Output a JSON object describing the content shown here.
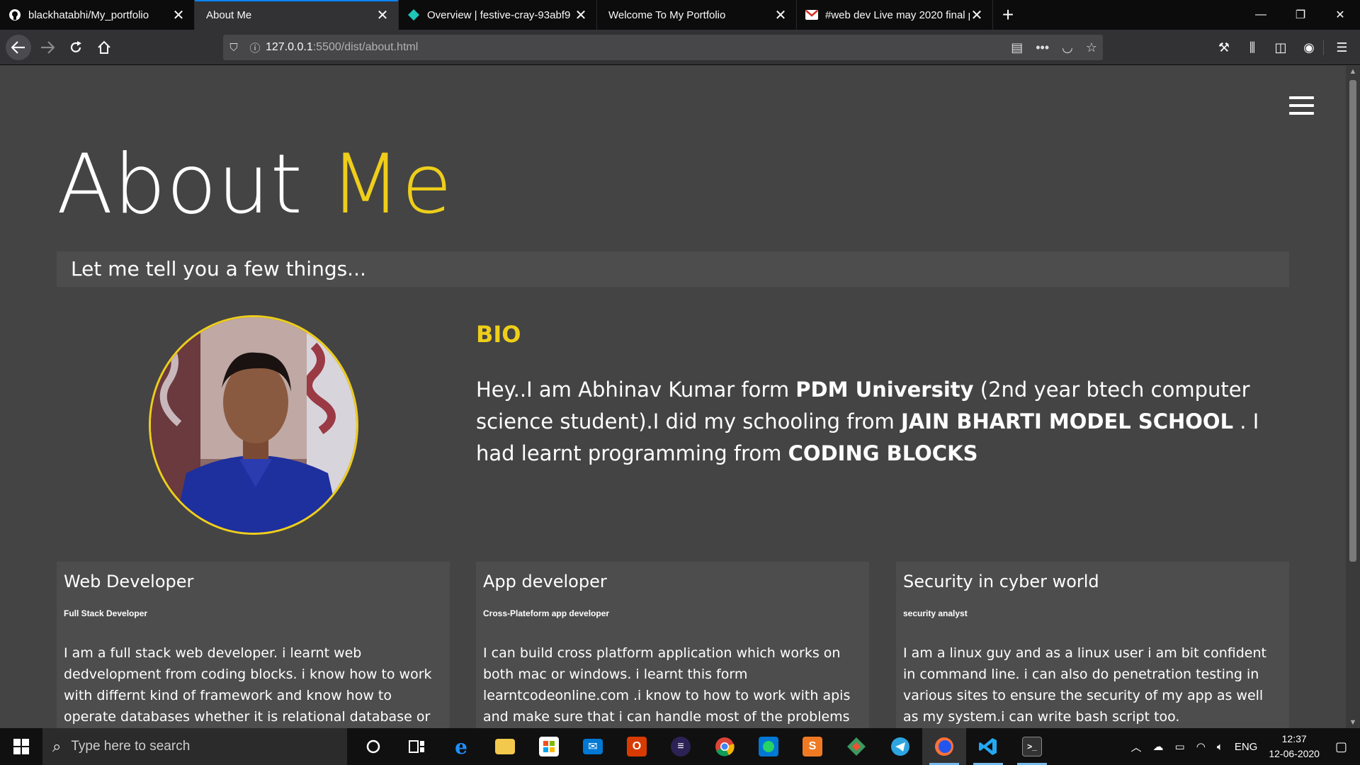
{
  "browser": {
    "tabs": [
      {
        "title": "blackhatabhi/My_portfolio",
        "icon": "github-icon",
        "active": false
      },
      {
        "title": "About Me",
        "icon": "",
        "active": true
      },
      {
        "title": "Overview | festive-cray-93abf9",
        "icon": "netlify-icon",
        "active": false
      },
      {
        "title": "Welcome To My Portfolio",
        "icon": "",
        "active": false
      },
      {
        "title": "#web dev Live may 2020 final p",
        "icon": "gmail-icon",
        "active": false
      }
    ],
    "new_tab": "+",
    "url_host": "127.0.0.1",
    "url_path": ":5500/dist/about.html"
  },
  "page": {
    "title_main": "About",
    "title_accent": "Me",
    "tagline": "Let me tell you a few things...",
    "bio_heading": "BIO",
    "bio": {
      "t1": "Hey..I am Abhinav Kumar form ",
      "b1": "PDM University",
      "t2": " (2nd year btech computer science student).I did my schooling from ",
      "b2": "JAIN BHARTI MODEL SCHOOL",
      "t3": " . I had learnt programming from ",
      "b3": "CODING BLOCKS"
    },
    "cards": [
      {
        "title": "Web Developer",
        "subtitle": "Full Stack Developer",
        "text": "I am a full stack web developer. i learnt web dedvelopment from coding blocks. i know how to work with differnt kind of framework and know how to operate databases whether it is relational database or object-oriented databases."
      },
      {
        "title": "App developer",
        "subtitle": "Cross-Plateform app developer",
        "text": "I can build cross platform application which works on both mac or windows. i learnt this form learntcodeonline.com .i know to how to work with apis and make sure that i can handle most of the problems while making the applications."
      },
      {
        "title": "Security in cyber world",
        "subtitle": "security analyst",
        "text": "I am a linux guy and as a linux user i am bit confident in command line. i can also do penetration testing in various sites to ensure the security of my app as well as my system.i can write bash script too."
      }
    ]
  },
  "taskbar": {
    "search_placeholder": "Type here to search",
    "lang": "ENG",
    "time": "12:37",
    "date": "12-06-2020"
  },
  "colors": {
    "accent": "#eece1a",
    "page_bg": "#444444",
    "tab_active_line": "#0a84ff"
  }
}
